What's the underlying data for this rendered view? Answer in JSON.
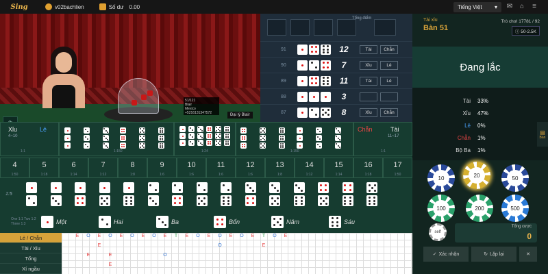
{
  "topbar": {
    "logo": "Sing",
    "username": "v02bachlien",
    "balance_label": "Số dư",
    "balance": "0.00",
    "language": "Tiếng Việt"
  },
  "video": {
    "viewers": "3",
    "agent": "Đại lý Blair",
    "card_line1": "51/121",
    "card_line2": "Blair",
    "card_line3": "Mexico",
    "card_line4": "+5216131347572"
  },
  "scoreboard": {
    "title": "Tổng điểm",
    "rows": [
      {
        "id": "91",
        "dice": [
          1,
          4,
          6
        ],
        "sum": "12",
        "tag1": "Tài",
        "tag2": "Chẵn"
      },
      {
        "id": "90",
        "dice": [
          1,
          2,
          4
        ],
        "sum": "7",
        "tag1": "Xỉu",
        "tag2": "Lẻ"
      },
      {
        "id": "89",
        "dice": [
          1,
          4,
          6
        ],
        "sum": "11",
        "tag1": "Tài",
        "tag2": "Lẻ"
      },
      {
        "id": "88",
        "dice": [
          1,
          1,
          1
        ],
        "sum": "3",
        "tag1": "",
        "tag2": ""
      },
      {
        "id": "87",
        "dice": [
          1,
          2,
          5
        ],
        "sum": "8",
        "tag1": "Xỉu",
        "tag2": "Chẵn"
      }
    ]
  },
  "table": {
    "label": "Tài xỉu",
    "name": "Bàn 51",
    "game_count": "Trò chơi 17781 / 92",
    "limit": "50-2.5K"
  },
  "status": "Đang lắc",
  "stats": [
    {
      "label": "Tài",
      "value": "33%",
      "color": "#d8d8d8"
    },
    {
      "label": "Xỉu",
      "value": "47%",
      "color": "#d8d8d8"
    },
    {
      "label": "Lẻ",
      "value": "0%",
      "color": "#4aa3ff"
    },
    {
      "label": "Chẵn",
      "value": "1%",
      "color": "#e84545"
    },
    {
      "label": "Bộ Ba",
      "value": "1%",
      "color": "#d8d8d8"
    }
  ],
  "chips": [
    "10",
    "20",
    "50",
    "100",
    "200",
    "500"
  ],
  "self_chip": "self",
  "total_bet": {
    "label": "Tổng cược",
    "value": "0"
  },
  "actions": {
    "cancel": "Xác nhận",
    "rebet": "Lặp lại"
  },
  "side_tab": "Bàn",
  "board": {
    "xiu": "Xỉu",
    "xiu_range": "4~10",
    "le": "Lẻ",
    "chan": "Chẵn",
    "tai": "Tài",
    "tai_range": "11~17",
    "odds_11": "1:1",
    "odds_24": "1:24",
    "odds_150": "1:150",
    "odds_8": "1:8",
    "totals": [
      {
        "n": "4",
        "o": "1:50"
      },
      {
        "n": "5",
        "o": "1:18"
      },
      {
        "n": "6",
        "o": "1:14"
      },
      {
        "n": "7",
        "o": "1:12"
      },
      {
        "n": "8",
        "o": "1:8"
      },
      {
        "n": "9",
        "o": "1:6"
      },
      {
        "n": "10",
        "o": "1:6"
      },
      {
        "n": "11",
        "o": "1:6"
      },
      {
        "n": "12",
        "o": "1:6"
      },
      {
        "n": "13",
        "o": "1:8"
      },
      {
        "n": "14",
        "o": "1:12"
      },
      {
        "n": "15",
        "o": "1:14"
      },
      {
        "n": "16",
        "o": "1:18"
      },
      {
        "n": "17",
        "o": "1:50"
      }
    ],
    "pair_odds": "1:5",
    "single_odds": "One 1:1 Two 1:2 Three 1:3",
    "singles": [
      "Một",
      "Hai",
      "Ba",
      "Bốn",
      "Năm",
      "Sáu"
    ]
  },
  "roadmap": {
    "tabs": [
      "Lẻ / Chẵn",
      "Tài / Xỉu",
      "Tổng",
      "Xí ngầu"
    ],
    "row1": [
      "E",
      "O",
      "E",
      "O",
      "E",
      "O",
      "E",
      "O",
      "E",
      "T",
      "E",
      "O",
      "E",
      "O",
      "E",
      "O",
      "E",
      "T",
      "O",
      "E"
    ],
    "row2": [
      "",
      "",
      "E",
      "",
      "",
      "",
      "",
      "",
      "",
      "",
      "",
      "",
      "",
      "O",
      "",
      "",
      "",
      "E",
      "",
      ""
    ],
    "row3": [
      "",
      "E",
      "",
      "E",
      "",
      "",
      "",
      "",
      "O",
      "",
      "",
      "",
      "",
      "",
      "",
      "",
      "",
      "",
      "",
      ""
    ],
    "row4": [
      "",
      "",
      "",
      "E",
      "",
      "",
      "",
      "",
      "",
      "",
      "",
      "",
      "",
      "",
      "",
      "",
      "",
      "",
      "",
      ""
    ]
  }
}
